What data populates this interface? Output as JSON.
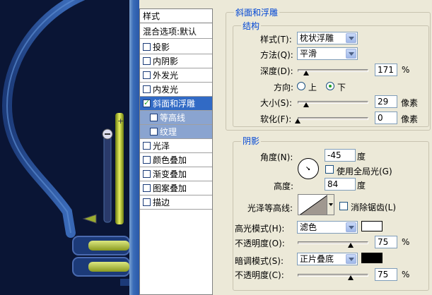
{
  "style_list": {
    "header": "样式",
    "blend_options": "混合选项:默认",
    "items": [
      {
        "label": "投影",
        "checked": false
      },
      {
        "label": "内阴影",
        "checked": false
      },
      {
        "label": "外发光",
        "checked": false
      },
      {
        "label": "内发光",
        "checked": false
      },
      {
        "label": "斜面和浮雕",
        "checked": true
      },
      {
        "label": "等高线",
        "checked": false
      },
      {
        "label": "纹理",
        "checked": false
      },
      {
        "label": "光泽",
        "checked": false
      },
      {
        "label": "颜色叠加",
        "checked": false
      },
      {
        "label": "渐变叠加",
        "checked": false
      },
      {
        "label": "图案叠加",
        "checked": false
      },
      {
        "label": "描边",
        "checked": false
      }
    ]
  },
  "bevel": {
    "section_title": "斜面和浮雕",
    "structure_title": "结构",
    "style_label": "样式(T):",
    "style_value": "枕状浮雕",
    "technique_label": "方法(Q):",
    "technique_value": "平滑",
    "depth_label": "深度(D):",
    "depth_value": "171",
    "depth_unit": "%",
    "depth_slider": 0.12,
    "direction_label": "方向:",
    "direction_up": "上",
    "direction_down": "下",
    "direction_selected": "下",
    "size_label": "大小(S):",
    "size_value": "29",
    "size_unit": "像素",
    "size_slider": 0.12,
    "soften_label": "软化(F):",
    "soften_value": "0",
    "soften_unit": "像素",
    "soften_slider": 0.0
  },
  "shading": {
    "title": "阴影",
    "angle_label": "角度(N):",
    "angle_value": "-45",
    "angle_unit": "度",
    "global_light_label": "使用全局光(G)",
    "global_light_checked": false,
    "altitude_label": "高度:",
    "altitude_value": "84",
    "altitude_unit": "度",
    "gloss_contour_label": "光泽等高线:",
    "antialias_label": "消除锯齿(L)",
    "antialias_checked": false,
    "highlight_mode_label": "高光模式(H):",
    "highlight_mode_value": "滤色",
    "highlight_color": "#ffffff",
    "highlight_opacity_label": "不透明度(O):",
    "highlight_opacity_value": "75",
    "highlight_opacity_unit": "%",
    "highlight_opacity_slider": 0.75,
    "shadow_mode_label": "暗调模式(S):",
    "shadow_mode_value": "正片叠底",
    "shadow_color": "#000000",
    "shadow_opacity_label": "不透明度(C):",
    "shadow_opacity_value": "75",
    "shadow_opacity_unit": "%",
    "shadow_opacity_slider": 0.75
  },
  "colors": {
    "accent": "#316ac5",
    "group_title": "#0046d5",
    "canvas_bg": "#0a1535",
    "bulb_glow": "#c8e040"
  }
}
